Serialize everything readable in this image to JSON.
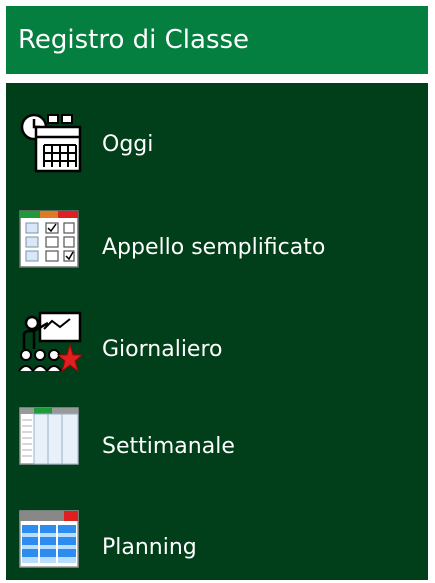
{
  "header": {
    "title": "Registro di Classe"
  },
  "menu": {
    "items": [
      {
        "label": "Oggi",
        "icon": "calendar-clock-icon"
      },
      {
        "label": "Appello semplificato",
        "icon": "attendance-checklist-icon"
      },
      {
        "label": "Giornaliero",
        "icon": "teacher-classroom-star-icon"
      },
      {
        "label": "Settimanale",
        "icon": "weekly-grid-icon"
      },
      {
        "label": "Planning",
        "icon": "planning-table-icon"
      }
    ]
  },
  "colors": {
    "header_bg": "#057f3f",
    "menu_bg": "#003f19",
    "text": "#ffffff",
    "accent_red": "#e02020",
    "accent_green": "#1f9a3a",
    "accent_blue": "#2c8cf0"
  }
}
